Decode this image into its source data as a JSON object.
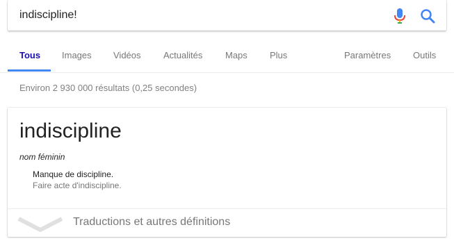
{
  "search": {
    "query": "indiscipline!"
  },
  "tabs": {
    "all": "Tous",
    "images": "Images",
    "videos": "Vidéos",
    "news": "Actualités",
    "maps": "Maps",
    "more": "Plus",
    "settings": "Paramètres",
    "tools": "Outils"
  },
  "results": {
    "stats": "Environ 2 930 000 résultats (0,25 secondes)"
  },
  "dictionary": {
    "word": "indiscipline",
    "part_of_speech": "nom féminin",
    "definition": "Manque de discipline.",
    "example": "Faire acte d'indiscipline.",
    "expand_label": "Traductions et autres définitions"
  },
  "colors": {
    "accent_blue": "#4285f4",
    "mic_red": "#ea4335",
    "mic_yellow": "#fbbc05",
    "mic_green": "#34a853"
  },
  "icons": {
    "mic": "microphone-icon",
    "search": "search-icon",
    "expand": "chevron-down-icon"
  }
}
